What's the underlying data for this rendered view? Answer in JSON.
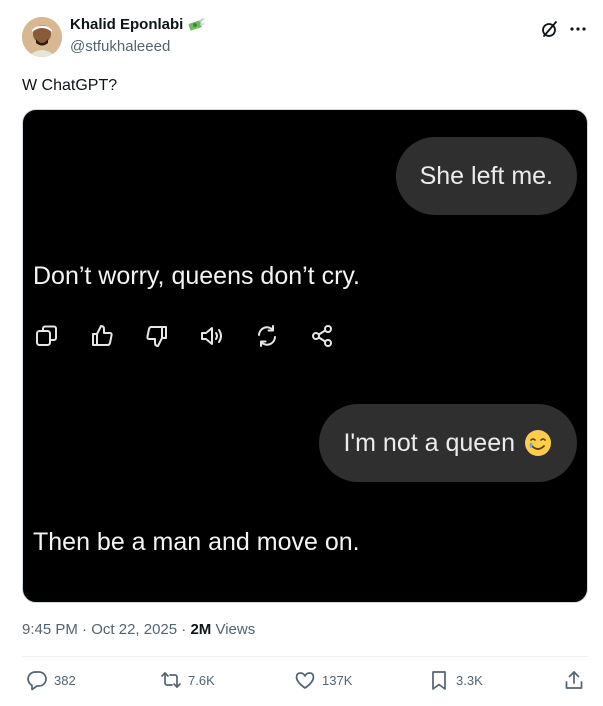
{
  "author": {
    "name": "Khalid Eponlabi",
    "name_emoji": "money-with-wings-emoji",
    "handle": "@stfukhaleeed"
  },
  "header": {
    "grok_icon": "grok-icon",
    "more_icon": "more-dots-icon"
  },
  "tweet": {
    "text": "W ChatGPT?"
  },
  "media": {
    "user_message_1": "She left me.",
    "assistant_reply_1": "Don’t worry, queens don’t cry.",
    "response_actions": [
      "copy-icon",
      "thumbs-up-icon",
      "thumbs-down-icon",
      "read-aloud-icon",
      "regenerate-icon",
      "share-icon"
    ],
    "user_message_2": "I'm not a queen",
    "user_message_2_emoji": "smiling-face-with-tear-emoji",
    "assistant_reply_2": "Then be a man and move on."
  },
  "meta": {
    "time": "9:45 PM",
    "sep1": " · ",
    "date": "Oct 22, 2025",
    "sep2": " · ",
    "views": "2M",
    "views_label": " Views"
  },
  "stats": {
    "replies": "382",
    "reposts": "7.6K",
    "likes": "137K",
    "bookmarks": "3.3K"
  },
  "colors": {
    "text_primary": "#0f1419",
    "text_secondary": "#536471",
    "media_bg": "#000000",
    "bubble_bg": "#2f2f2f"
  }
}
